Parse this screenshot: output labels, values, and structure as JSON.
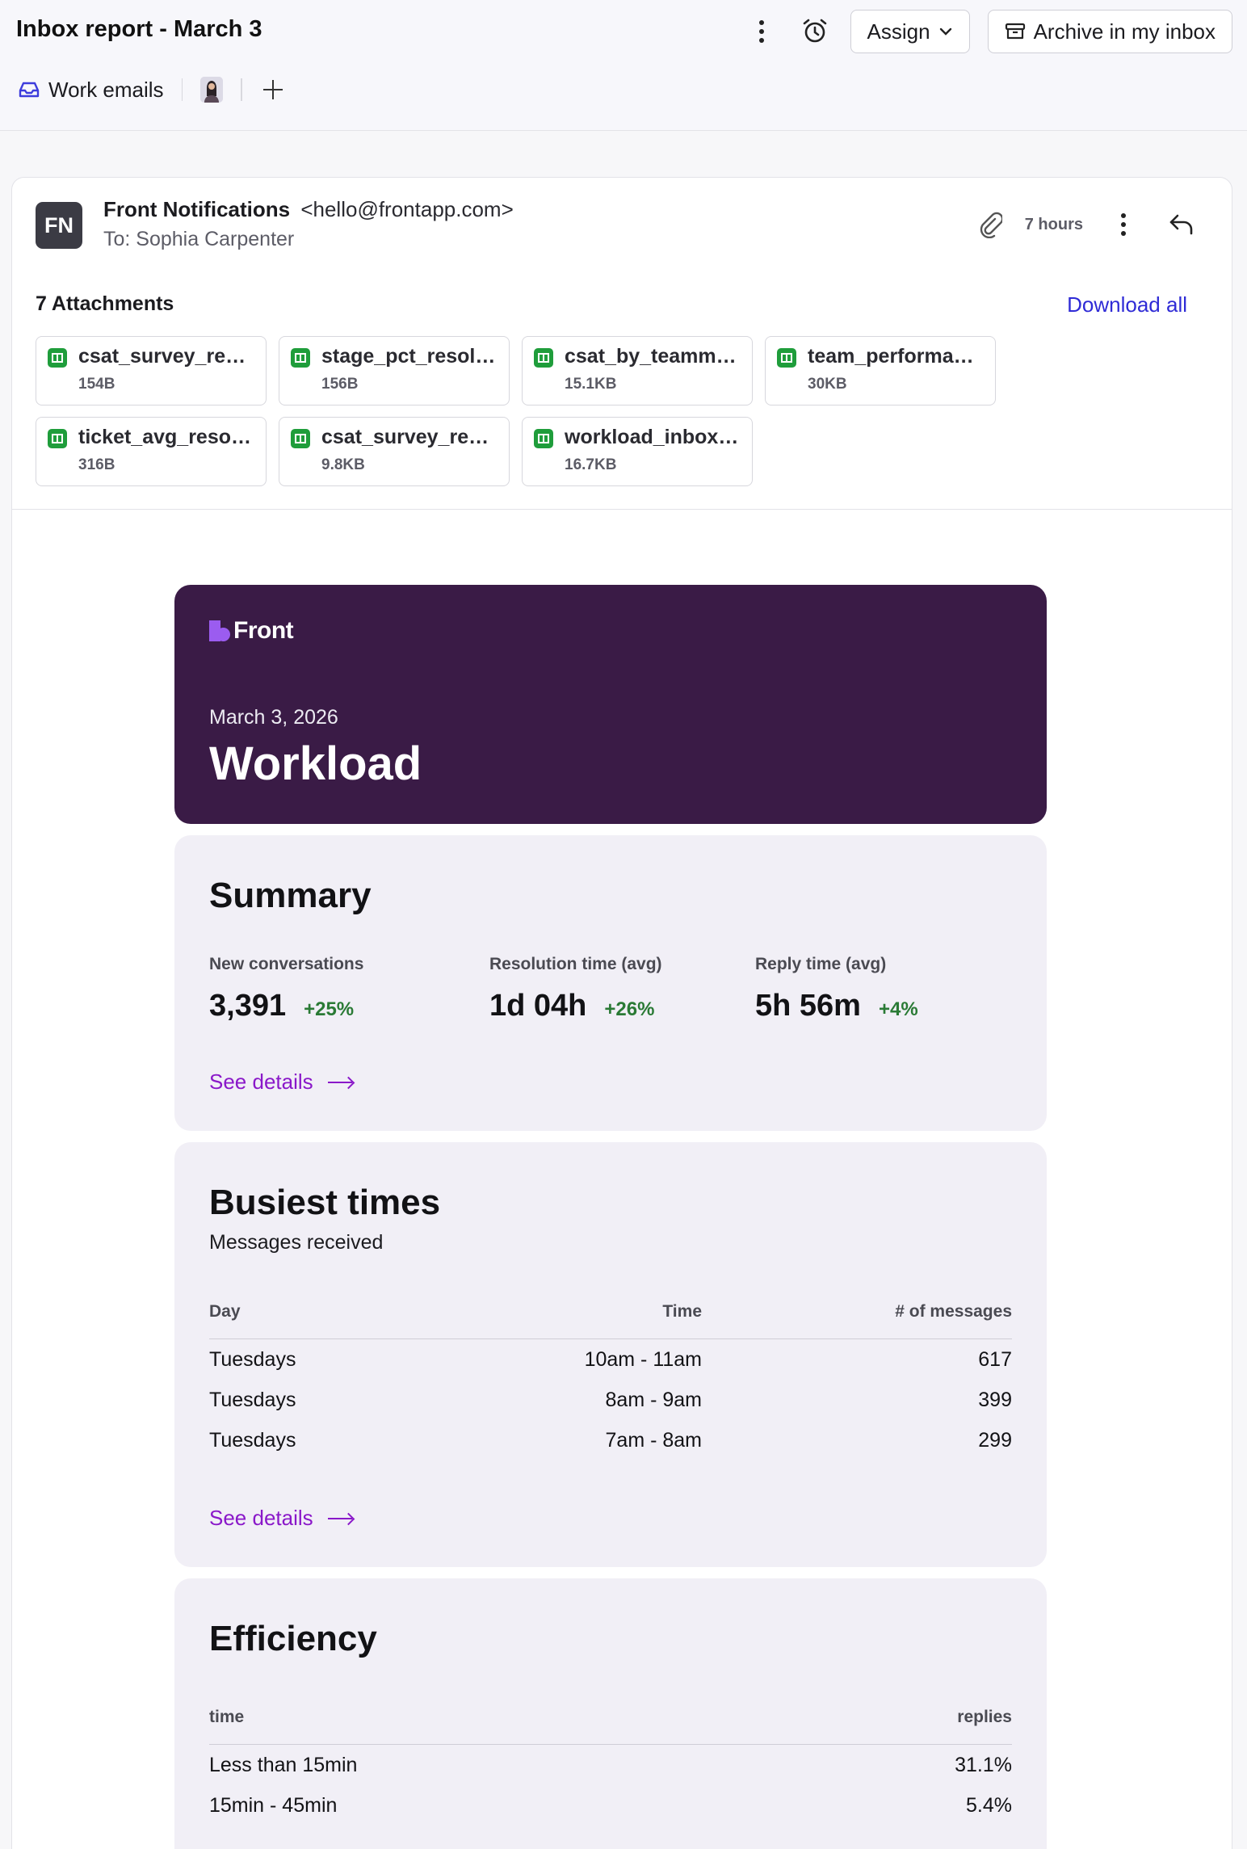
{
  "header": {
    "title": "Inbox report - March 3",
    "assign_label": "Assign",
    "archive_label": "Archive in my inbox",
    "inbox_tag": "Work emails"
  },
  "message": {
    "sender_initials": "FN",
    "sender_name": "Front Notifications",
    "sender_email": "<hello@frontapp.com>",
    "recipient": "To: Sophia Carpenter",
    "time": "7 hours",
    "attachments_label": "7 Attachments",
    "download_all_label": "Download all",
    "attachments": [
      {
        "name": "csat_survey_responses.csv",
        "size": "154B"
      },
      {
        "name": "stage_pct_resolved.csv",
        "size": "156B"
      },
      {
        "name": "csat_by_teammate.csv",
        "size": "15.1KB"
      },
      {
        "name": "team_performance.csv",
        "size": "30KB"
      },
      {
        "name": "ticket_avg_resolution.csv",
        "size": "316B"
      },
      {
        "name": "csat_survey_responses.csv",
        "size": "9.8KB"
      },
      {
        "name": "workload_inbox.csv",
        "size": "16.7KB"
      }
    ]
  },
  "report": {
    "logo_text": "Front",
    "date": "March 3, 2026",
    "title": "Workload",
    "summary": {
      "title": "Summary",
      "stats": [
        {
          "label": "New conversations",
          "value": "3,391",
          "delta": "+25%"
        },
        {
          "label": "Resolution time (avg)",
          "value": "1d 04h",
          "delta": "+26%"
        },
        {
          "label": "Reply time (avg)",
          "value": "5h 56m",
          "delta": "+4%"
        }
      ],
      "see_details": "See details"
    },
    "busiest": {
      "title": "Busiest times",
      "subtitle": "Messages received",
      "columns": [
        "Day",
        "Time",
        "# of messages"
      ],
      "rows": [
        [
          "Tuesdays",
          "10am - 11am",
          "617"
        ],
        [
          "Tuesdays",
          "8am - 9am",
          "399"
        ],
        [
          "Tuesdays",
          "7am - 8am",
          "299"
        ]
      ],
      "see_details": "See details"
    },
    "efficiency": {
      "title": "Efficiency",
      "columns": [
        "time",
        "replies"
      ],
      "rows": [
        [
          "Less than 15min",
          "31.1%"
        ],
        [
          "15min - 45min",
          "5.4%"
        ]
      ]
    }
  }
}
